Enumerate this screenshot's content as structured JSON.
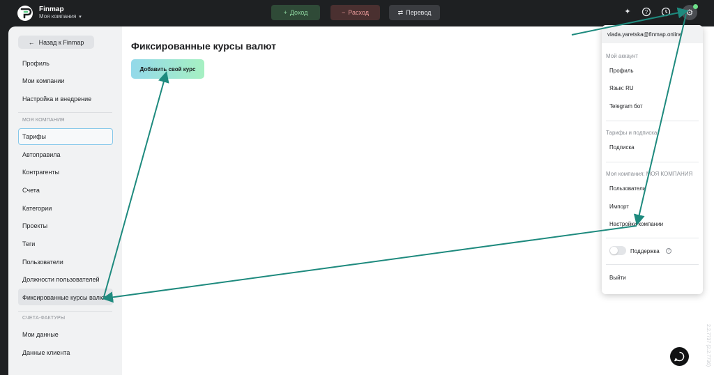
{
  "header": {
    "brand": "Finmap",
    "company": "Моя компания",
    "caret": "▾",
    "income_label": "Доход",
    "income_icon": "+",
    "expense_label": "Расход",
    "expense_icon": "−",
    "transfer_label": "Перевод",
    "transfer_icon": "⇄"
  },
  "sidebar": {
    "back_label": "Назад к Finmap",
    "back_icon": "←",
    "items_top": [
      "Профиль",
      "Мои компании",
      "Настройка и внедрение"
    ],
    "section_company": "МОЯ КОМПАНИЯ",
    "items_company": [
      "Тарифы",
      "Автоправила",
      "Контрагенты",
      "Счета",
      "Категории",
      "Проекты",
      "Теги",
      "Пользователи",
      "Должности пользователей",
      "Фиксированные курсы валют"
    ],
    "section_invoices": "СЧЕТА-ФАКТУРЫ",
    "items_invoices": [
      "Мои данные",
      "Данные клиента"
    ]
  },
  "main": {
    "title": "Фиксированные курсы валют",
    "add_button": "Добавить свой курс"
  },
  "dropdown": {
    "email": "vlada.yaretska@finmap.online",
    "account_header": "Мой аккаунт",
    "account_items": [
      "Профиль",
      "Язык: RU",
      "Telegram бот"
    ],
    "plans_header": "Тарифы и подписка",
    "plans_items": [
      "Подписка"
    ],
    "company_header": "Моя компания: МОЯ КОМПАНИЯ",
    "company_items": [
      "Пользователи",
      "Импорт",
      "Настройки компании"
    ],
    "support_label": "Поддержка",
    "logout": "Выйти"
  },
  "version": "2.2.7737 (2.2.7736)",
  "colors": {
    "accent_arrow": "#1e8a7e",
    "income": "#8fd6a0",
    "expense": "#e99a9a",
    "notification_dot": "#6ee08a"
  }
}
